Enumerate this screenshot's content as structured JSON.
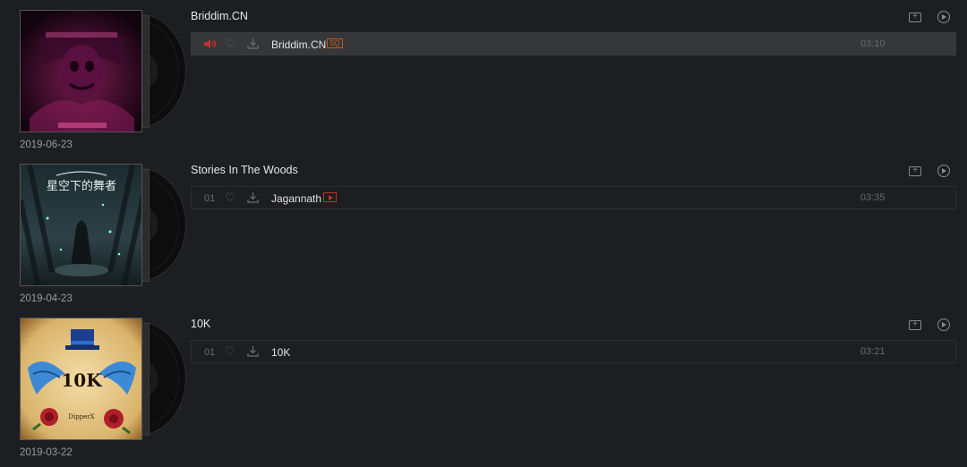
{
  "albums": [
    {
      "title": "Briddim.CN",
      "date": "2019-06-23",
      "cover_icon": "dark-red-masked-figure-cover",
      "tracks": [
        {
          "number": "",
          "playing": true,
          "name": "Briddim.CN",
          "badge": "SQ",
          "mv": false,
          "duration": "03:10"
        }
      ]
    },
    {
      "title": "Stories In The Woods",
      "date": "2019-04-23",
      "cover_icon": "forest-figure-cover",
      "cover_text": "星空下的舞者",
      "tracks": [
        {
          "number": "01",
          "playing": false,
          "name": "Jagannath",
          "badge": "",
          "mv": true,
          "duration": "03:35"
        }
      ]
    },
    {
      "title": "10K",
      "date": "2019-03-22",
      "cover_icon": "parchment-top-hat-wings-roses-cover",
      "cover_text": "10K",
      "cover_subtext": "DipperX",
      "tracks": [
        {
          "number": "01",
          "playing": false,
          "name": "10K",
          "badge": "",
          "mv": false,
          "duration": "03:21"
        }
      ]
    }
  ],
  "icons": {
    "add_to_folder": "folder-add-icon",
    "play_all": "play-circle-icon",
    "like": "heart-icon",
    "download": "download-icon",
    "now_playing": "speaker-icon",
    "mv": "mv-play-icon"
  },
  "colors": {
    "background": "#1d1e21",
    "active_row": "#36373a",
    "accent_red": "#c6312d",
    "sq_badge": "#c85a1e"
  }
}
